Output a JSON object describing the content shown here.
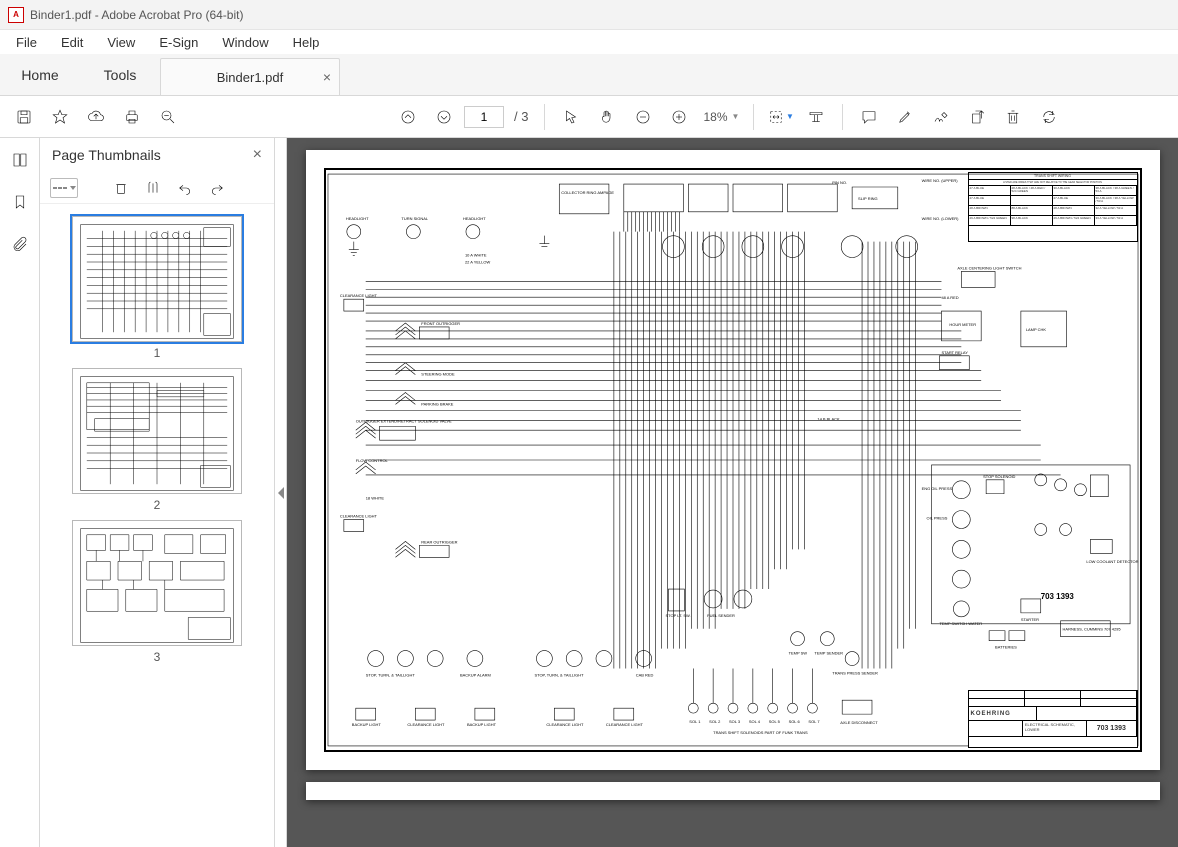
{
  "window": {
    "title": "Binder1.pdf - Adobe Acrobat Pro (64-bit)"
  },
  "menu": [
    "File",
    "Edit",
    "View",
    "E-Sign",
    "Window",
    "Help"
  ],
  "tabs": {
    "home": "Home",
    "tools": "Tools",
    "doc": "Binder1.pdf"
  },
  "toolbar": {
    "page_current": "1",
    "page_sep": "/",
    "page_total": "3",
    "zoom": "18%"
  },
  "thumbnails": {
    "title": "Page Thumbnails",
    "pages": [
      {
        "num": "1"
      },
      {
        "num": "2"
      },
      {
        "num": "3"
      }
    ]
  },
  "document": {
    "drawing_number": "703 1393",
    "drawing_title_l1": "ELECTRICAL SCHEMATIC,",
    "drawing_title_l2": "LOWER",
    "brand": "KOEHRING",
    "wire_table_title": "TRANS SHIFT WIRING",
    "wire_table_sub": "LISTED ARE WIRES THAT ARE NOT RELATIVE TO THE GEAR SELECTOR POSITION",
    "labels": {
      "headlight": "HEADLIGHT",
      "turn_signal": "TURN SIGNAL",
      "clearance_light": "CLEARANCE LIGHT",
      "front_outrigger": "FRONT OUTRIGGER",
      "rear_outrigger": "REAR OUTRIGGER",
      "steering_mode": "STEERING MODE",
      "parking_brake": "PARKING BRAKE",
      "backup_light": "BACKUP LIGHT",
      "backup_alarm": "BACKUP ALARM",
      "stop_turn_taillight": "STOP, TURN, & TAILLIGHT",
      "cab_red": "CAB RED",
      "flow_control": "FLOW CONTROL",
      "fuel_sender": "FUEL SENDER",
      "stop_lt_sw": "STOP LT. SW.",
      "temp_sw": "TEMP SW",
      "temp_sender": "TEMP SENDER",
      "trans_press_sender": "TRANS PRESS SENDER",
      "trans_shift_solenoids": "TRANS SHIFT SOLENOIDS PART OF FUNK TRANS",
      "axle_disconnect": "AXLE DISCONNECT",
      "stop_solenoid": "STOP SOLENOID",
      "starter": "STARTER",
      "batteries": "BATTERIES",
      "hour_meter": "HOUR METER",
      "start_relay": "START RELAY",
      "axle_centering": "AXLE CENTERING LIGHT SWITCH",
      "collector_ring": "COLLECTOR RING AMPAGE",
      "slip_ring": "SLIP RING",
      "pin_no": "PIN NO.",
      "wire_upper": "WIRE NO. (UPPER)",
      "wire_lower": "WIRE NO. (LOWER)",
      "eng_oil_press": "ENG OIL PRESS",
      "oil_press": "OIL PRESS",
      "low_coolant": "LOW COOLANT DETECTOR",
      "temp_switch_water": "TEMP SWITCH WATER",
      "harness_cummins": "HARNESS, CUMMINS 707 4295",
      "sol1": "SOL 1",
      "sol2": "SOL 2",
      "sol3": "SOL 3",
      "sol4": "SOL 4",
      "sol5": "SOL 5",
      "sol6": "SOL 6",
      "sol7": "SOL 7",
      "outrigger_solenoid": "OUTRIGGER EXTEND/RETRACT SOLENOID VALVE",
      "lamp_check": "LAMP CHK"
    },
    "wires": {
      "w10awhite": "10 A WHITE",
      "w22ayellow": "22 A YELLOW",
      "w18white": "18 WHITE",
      "w14black": "14 B BLACK",
      "w30ablack": "30 A BLACK",
      "w48ared": "48 A RED",
      "w524green": "524 GREEN"
    },
    "wire_table": [
      [
        "27 A BLUE",
        "28 A BLACK / 48 A RED / 524 GREEN",
        "30 A BLACK",
        "38 A BLACK / 38 A GREEN / 53 A"
      ],
      [
        "27 A BLUE",
        "",
        "27 A BLUE",
        "30 A BLACK / 38 A YELLOW / 53 A"
      ],
      [
        "28 A BROWN",
        "88 A BLACK",
        "28 A BROWN",
        "32 A YELLOW / 53 A"
      ],
      [
        "29 A BROWN / 524 GREEN",
        "98 A BLACK",
        "29 A BROWN / 524 GREEN",
        "33 A YELLOW / 53 A"
      ]
    ]
  }
}
